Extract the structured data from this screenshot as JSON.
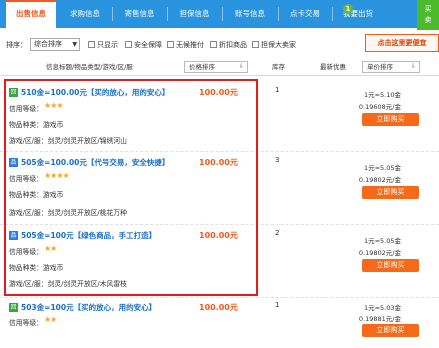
{
  "tabs": [
    {
      "label": "出售信息",
      "active": true
    },
    {
      "label": "求购信息",
      "active": false
    },
    {
      "label": "寄售信息",
      "active": false
    },
    {
      "label": "担保信息",
      "active": false
    },
    {
      "label": "账号信息",
      "active": false
    },
    {
      "label": "点卡交易",
      "active": false
    },
    {
      "label": "我要出货",
      "active": false
    }
  ],
  "tab_badge": "1",
  "corner_label": "买\n卖",
  "filter": {
    "sort_label": "排序：",
    "sort_value": "综合排序",
    "show_label": "只显示",
    "options": [
      "安全保障",
      "无候推付",
      "折扣商品",
      "担保大卖家"
    ]
  },
  "tip": "点击这里更便宜",
  "header": {
    "info_col": "信息标题/物品类型/游戏/区/服",
    "price_sort": "价格排序",
    "stock_col": "库存",
    "best_col": "最新优惠",
    "unit_sort": "单价排序"
  },
  "listings": [
    {
      "badge": "回",
      "title": "510金=100.00元【买的放心，用的安心】",
      "price": "100.00元",
      "stock": "1",
      "credit_label": "信用等级：",
      "stars": "★★★",
      "type_label": "物品种类：游戏币",
      "server_label": "游戏/区/服：剑灵/剑灵开放区/锦绣河山",
      "rate1": "1元=5.10金",
      "rate2": "0.19608元/金",
      "buy": "立即购买"
    },
    {
      "badge": "品",
      "title": "505金=100.00元【代号交易，安全快捷】",
      "price": "100.00元",
      "stock": "3",
      "credit_label": "信用等级：",
      "stars": "★★★★",
      "type_label": "物品种类：游戏币",
      "server_label": "游戏/区/服：剑灵/剑灵开放区/桃花万种",
      "rate1": "1元=5.05金",
      "rate2": "0.19802元/金",
      "buy": "立即购买"
    },
    {
      "badge": "品",
      "title": "505金=100元【绿色商品，手工打造】",
      "price": "100.00元",
      "stock": "2",
      "credit_label": "信用等级：",
      "stars": "★★",
      "type_label": "物品种类：游戏币",
      "server_label": "游戏/区/服：剑灵/剑灵开放区/木风雷枝",
      "rate1": "1元=5.05金",
      "rate2": "0.19802元/金",
      "buy": "立即购买"
    },
    {
      "badge": "回",
      "title": "503金=100元【买的放心，用的安心】",
      "price": "100.00元",
      "stock": "1",
      "credit_label": "信用等级：",
      "stars": "★★",
      "rate1": "1元=5.03金",
      "rate2": "0.19881元/金",
      "buy": "立即购买"
    }
  ],
  "colors": {
    "tabbar": "#2a93e0",
    "accent": "#f15a1b",
    "link": "#1a6fc9",
    "highlight_border": "#e01e1e",
    "buy_button": "#f56a1a"
  }
}
